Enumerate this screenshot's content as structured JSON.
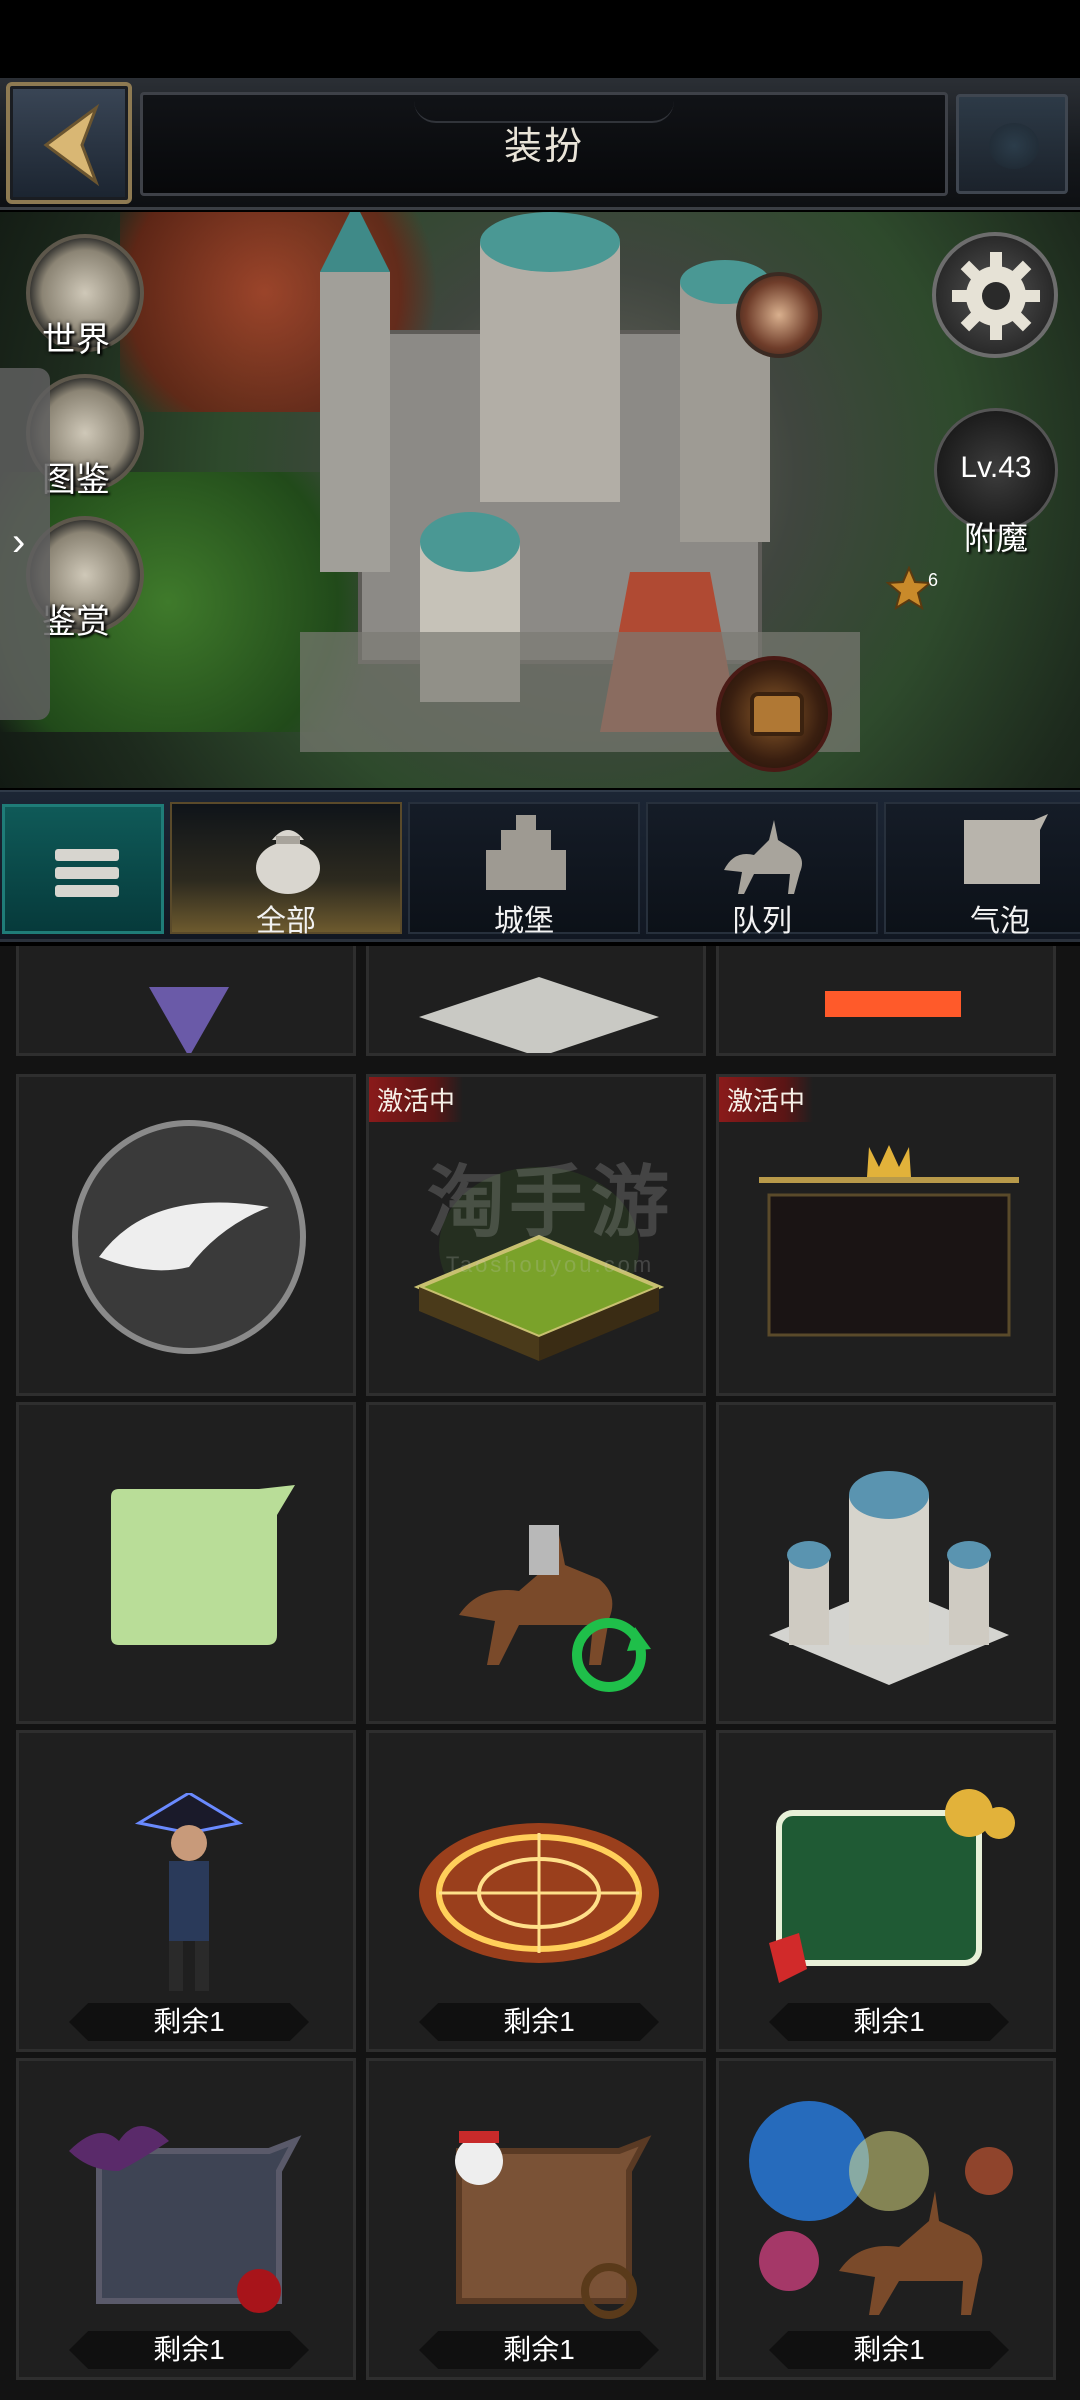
{
  "header": {
    "title": "装扮"
  },
  "scene": {
    "side_buttons": [
      {
        "label": "世界"
      },
      {
        "label": "图鉴"
      },
      {
        "label": "鉴赏"
      }
    ],
    "level_label": "Lv.43",
    "enchant_label": "附魔",
    "star_count": "6"
  },
  "tabs": [
    {
      "label": "全部",
      "active": true
    },
    {
      "label": "城堡",
      "active": false
    },
    {
      "label": "队列",
      "active": false
    },
    {
      "label": "气泡",
      "active": false
    }
  ],
  "grid": {
    "active_badge": "激活中",
    "remaining_label": "剩余1"
  },
  "watermark": {
    "line1": "淘手游",
    "line2": "Taoshouyou.com"
  }
}
